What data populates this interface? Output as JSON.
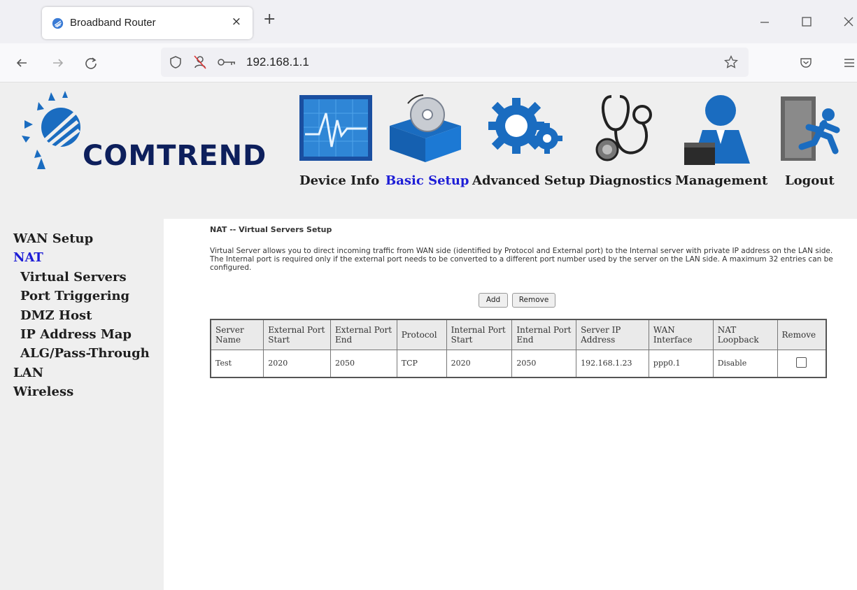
{
  "browser": {
    "tab_title": "Broadband Router",
    "tab_close": "×",
    "new_tab": "+",
    "url": "192.168.1.1",
    "icons": [
      "back-icon",
      "forward-icon",
      "reload-icon",
      "shield-icon",
      "no-camera-icon",
      "key-icon",
      "bookmark-star-icon",
      "pocket-icon",
      "menu-icon",
      "minimize-icon",
      "maximize-icon",
      "close-icon"
    ]
  },
  "brand": "COMTREND",
  "main_nav": [
    {
      "label": "Device Info",
      "icon": "device-info-icon",
      "active": false
    },
    {
      "label": "Basic Setup",
      "icon": "basic-setup-icon",
      "active": true
    },
    {
      "label": "Advanced Setup",
      "icon": "advanced-setup-icon",
      "active": false
    },
    {
      "label": "Diagnostics",
      "icon": "diagnostics-icon",
      "active": false
    },
    {
      "label": "Management",
      "icon": "management-icon",
      "active": false
    },
    {
      "label": "Logout",
      "icon": "logout-icon",
      "active": false
    }
  ],
  "sidebar": {
    "items": [
      {
        "label": "WAN Setup",
        "level": 0,
        "active": false
      },
      {
        "label": "NAT",
        "level": 0,
        "active": true
      },
      {
        "label": "Virtual Servers",
        "level": 1,
        "active": false
      },
      {
        "label": "Port Triggering",
        "level": 1,
        "active": false
      },
      {
        "label": "DMZ Host",
        "level": 1,
        "active": false
      },
      {
        "label": "IP Address Map",
        "level": 1,
        "active": false
      },
      {
        "label": "ALG/Pass-Through",
        "level": 1,
        "active": false
      },
      {
        "label": "LAN",
        "level": 0,
        "active": false
      },
      {
        "label": "Wireless",
        "level": 0,
        "active": false
      }
    ]
  },
  "page": {
    "title": "NAT -- Virtual Servers Setup",
    "description": "Virtual Server allows you to direct incoming traffic from WAN side (identified by Protocol and External port) to the Internal server with private IP address on the LAN side. The Internal port is required only if the external port needs to be converted to a different port number used by the server on the LAN side. A maximum 32 entries can be configured.",
    "add_label": "Add",
    "remove_label": "Remove"
  },
  "table": {
    "headers": [
      "Server Name",
      "External Port Start",
      "External Port End",
      "Protocol",
      "Internal Port Start",
      "Internal Port End",
      "Server IP Address",
      "WAN Interface",
      "NAT Loopback",
      "Remove"
    ],
    "rows": [
      [
        "Test",
        "2020",
        "2050",
        "TCP",
        "2020",
        "2050",
        "192.168.1.23",
        "ppp0.1",
        "Disable"
      ]
    ]
  },
  "colors": {
    "active_link": "#1d1dd6",
    "brand_navy": "#0d1f5c",
    "icon_blue": "#1a6cc0",
    "panel_gray": "#efefef"
  }
}
